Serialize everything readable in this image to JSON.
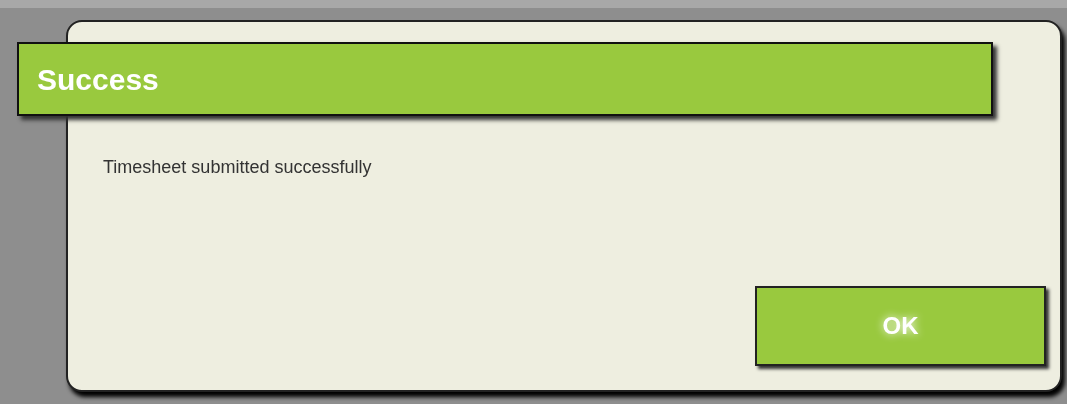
{
  "dialog": {
    "title": "Success",
    "message": "Timesheet submitted successfully",
    "buttons": [
      "OK"
    ]
  }
}
